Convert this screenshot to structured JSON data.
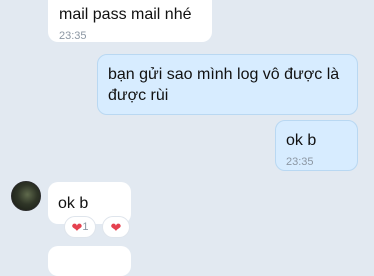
{
  "messages": [
    {
      "text": "mail pass mail nhé",
      "time": "23:35"
    },
    {
      "text": "bạn gửi sao mình log vô được là được rùi"
    },
    {
      "text": "ok b",
      "time": "23:35"
    },
    {
      "text": "ok b"
    }
  ],
  "reactions": {
    "heart_count": "1",
    "heart_icon": "heart-icon"
  },
  "colors": {
    "background": "#e2e9f1",
    "incoming_bubble": "#ffffff",
    "outgoing_bubble": "#d7ecff",
    "heart": "#e5414f"
  }
}
